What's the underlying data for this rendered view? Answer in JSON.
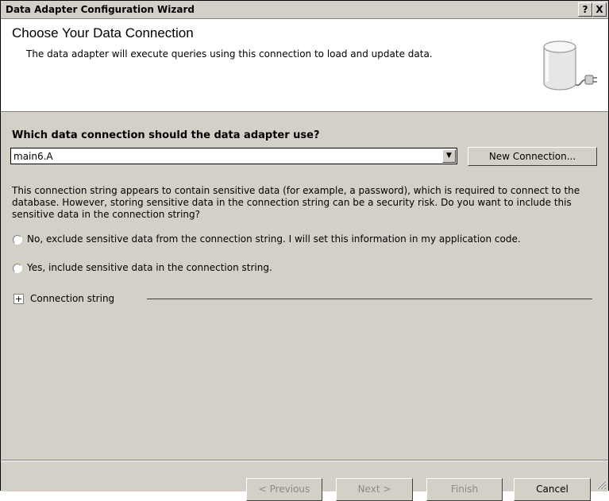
{
  "window": {
    "title": "Data Adapter Configuration Wizard",
    "help_label": "?",
    "close_label": "X"
  },
  "header": {
    "title": "Choose Your Data Connection",
    "subtitle": "The data adapter will execute queries using this connection to load and update data.",
    "icon": "database-plug-icon"
  },
  "connection": {
    "question": "Which data connection should the data adapter use?",
    "selected": "main6.A",
    "dropdown_icon": "▼",
    "new_connection_label": "New Connection..."
  },
  "sensitive": {
    "message": "This connection string appears to contain sensitive data (for example, a password), which is required to connect to the database. However, storing sensitive data in the connection string can be a security risk. Do you want to include this sensitive data in the connection string?",
    "options": [
      {
        "label": "No, exclude sensitive data from the connection string. I will set this information in my application code.",
        "checked": false
      },
      {
        "label": "Yes, include sensitive data in the connection string.",
        "checked": false
      }
    ]
  },
  "connection_string": {
    "expand_symbol": "+",
    "label": "Connection string"
  },
  "footer": {
    "previous_label": "< Previous",
    "next_label": "Next >",
    "finish_label": "Finish",
    "cancel_label": "Cancel"
  },
  "colors": {
    "dialog_face": "#d4d0c8",
    "header_background": "#ffffff",
    "disabled_text": "#8a8a8a"
  }
}
